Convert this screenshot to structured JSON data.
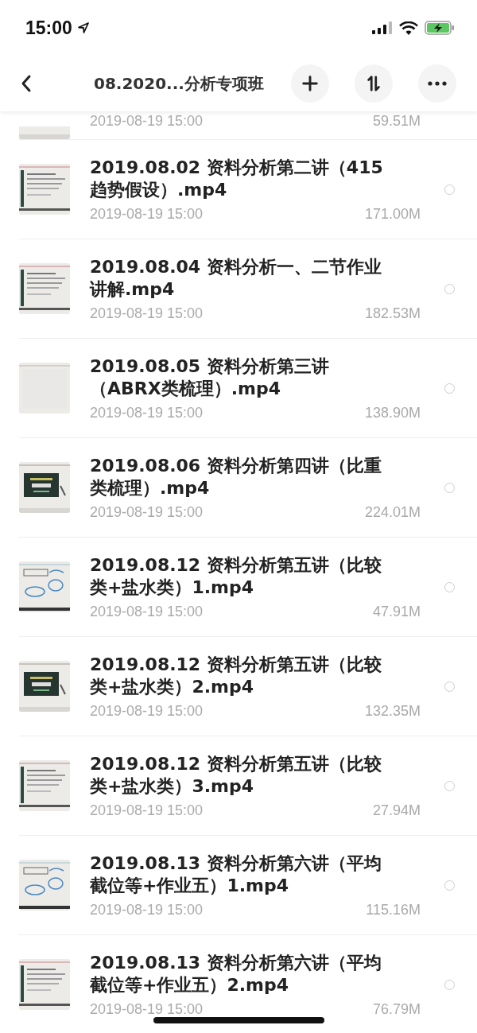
{
  "status_bar": {
    "time": "15:00"
  },
  "nav": {
    "title": "08.2020...分析专项班"
  },
  "files": [
    {
      "kind": "partial",
      "date": "2019-08-19 15:00",
      "size": "59.51M"
    },
    {
      "kind": "full",
      "title": "2019.08.02 资料分析第二讲（415趋势假设）.mp4",
      "date": "2019-08-19 15:00",
      "size": "171.00M",
      "selected": false
    },
    {
      "kind": "full",
      "title": "2019.08.04 资料分析一、二节作业讲解.mp4",
      "date": "2019-08-19 15:00",
      "size": "182.53M",
      "selected": false
    },
    {
      "kind": "full",
      "title": "2019.08.05 资料分析第三讲（ABRX类梳理）.mp4",
      "date": "2019-08-19 15:00",
      "size": "138.90M",
      "selected": false
    },
    {
      "kind": "full",
      "title": "2019.08.06 资料分析第四讲（比重类梳理）.mp4",
      "date": "2019-08-19 15:00",
      "size": "224.01M",
      "selected": false
    },
    {
      "kind": "full",
      "title": "2019.08.12 资料分析第五讲（比较类+盐水类）1.mp4",
      "date": "2019-08-19 15:00",
      "size": "47.91M",
      "selected": false
    },
    {
      "kind": "full",
      "title": "2019.08.12 资料分析第五讲（比较类+盐水类）2.mp4",
      "date": "2019-08-19 15:00",
      "size": "132.35M",
      "selected": false
    },
    {
      "kind": "full",
      "title": "2019.08.12 资料分析第五讲（比较类+盐水类）3.mp4",
      "date": "2019-08-19 15:00",
      "size": "27.94M",
      "selected": false
    },
    {
      "kind": "full",
      "title": "2019.08.13 资料分析第六讲（平均截位等+作业五）1.mp4",
      "date": "2019-08-19 15:00",
      "size": "115.16M",
      "selected": false
    },
    {
      "kind": "full",
      "title": "2019.08.13 资料分析第六讲（平均截位等+作业五）2.mp4",
      "date": "2019-08-19 15:00",
      "size": "76.79M",
      "selected": false
    }
  ]
}
